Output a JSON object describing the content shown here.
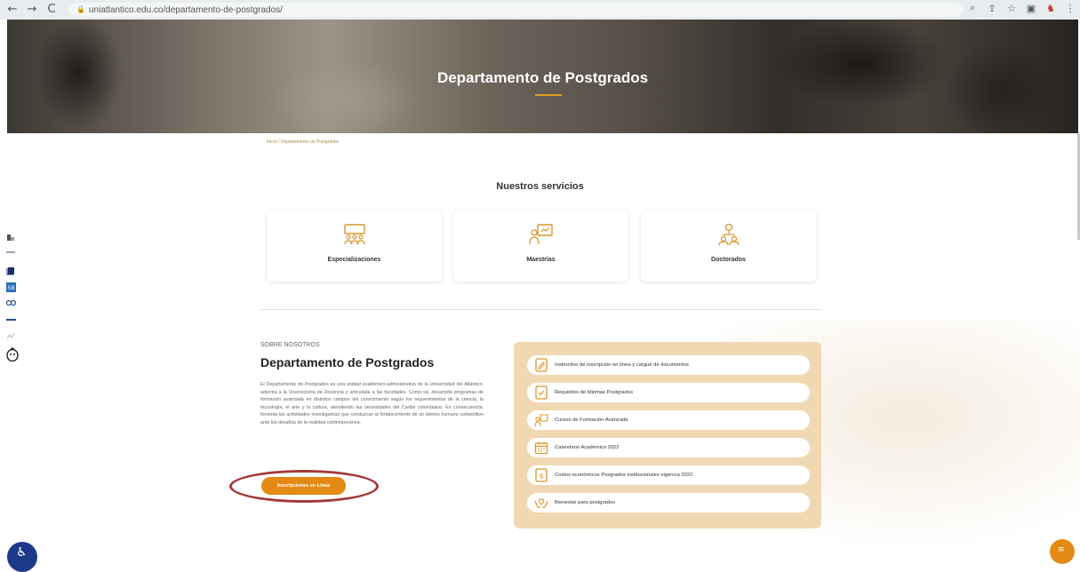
{
  "browser": {
    "url": "uniatlantico.edu.co/departamento-de-postgrados/",
    "back_icon": "←",
    "forward_icon": "→",
    "reload_icon": "C",
    "lock_icon": "lock-icon",
    "right_icons": [
      "zoom-icon",
      "share-icon",
      "star-icon",
      "sidebar-icon",
      "extension-icon",
      "menu-icon"
    ]
  },
  "hero": {
    "title": "Departamento de Postgrados",
    "accent_color": "#e0a020"
  },
  "breadcrumb": "Inicio / Departamento de Postgrados",
  "services": {
    "title": "Nuestros servicios",
    "cards": [
      {
        "label": "Especializaciones",
        "icon": "group-presentation-icon"
      },
      {
        "label": "Maestrías",
        "icon": "teacher-board-icon"
      },
      {
        "label": "Doctorados",
        "icon": "people-hierarchy-icon"
      }
    ]
  },
  "about": {
    "kicker": "SOBRE NOSOTROS",
    "title": "Departamento de Postgrados",
    "body": "El Departamento de Postgrados es una unidad académico-administrativa de la Universidad del Atlántico, adscrita a la Vicerrectoría de Docencia y articulada a las facultades. Como tal, desarrolla programas de formación avanzada en distintos campos del conocimiento según los requerimientos de la ciencia, la tecnología, el arte y la cultura, atendiendo las necesidades del Caribe colombiano. En consecuencia, fomenta las actividades investigativas que conduzcan al fortalecimiento de un talento humano competitivo ante los desafíos de la realidad contemporánea.",
    "button_label": "Inscripciones en Línea"
  },
  "links": [
    {
      "label": "Instructivo de inscripción en línea y cargue de documentos",
      "icon": "pen-document-icon"
    },
    {
      "label": "Requisitos de Idiomas Postgrados",
      "icon": "checklist-document-icon"
    },
    {
      "label": "Cursos de Formación Avanzada",
      "icon": "teacher-board-icon"
    },
    {
      "label": "Calendario Académico 2022",
      "icon": "calendar-icon"
    },
    {
      "label": "Costos económicos Posgrados institucionales vigencia 2022",
      "icon": "money-document-icon"
    },
    {
      "label": "Bienestar para postgrados",
      "icon": "hands-heart-icon"
    }
  ],
  "sidebar_icons": [
    "institution-logo-icon",
    "gov-logo-icon",
    "book-icon",
    "library-logo-icon",
    "partner-logo-icon",
    "network-logo-icon",
    "brand-logo-icon",
    "chat-bot-icon"
  ],
  "colors": {
    "accent": "#e38a14",
    "panel": "#f0d9b2",
    "highlight_ring": "#a33a3a",
    "accessibility": "#1d3a8a"
  },
  "chat_glyph": "≡",
  "a11y_glyph": "♿"
}
